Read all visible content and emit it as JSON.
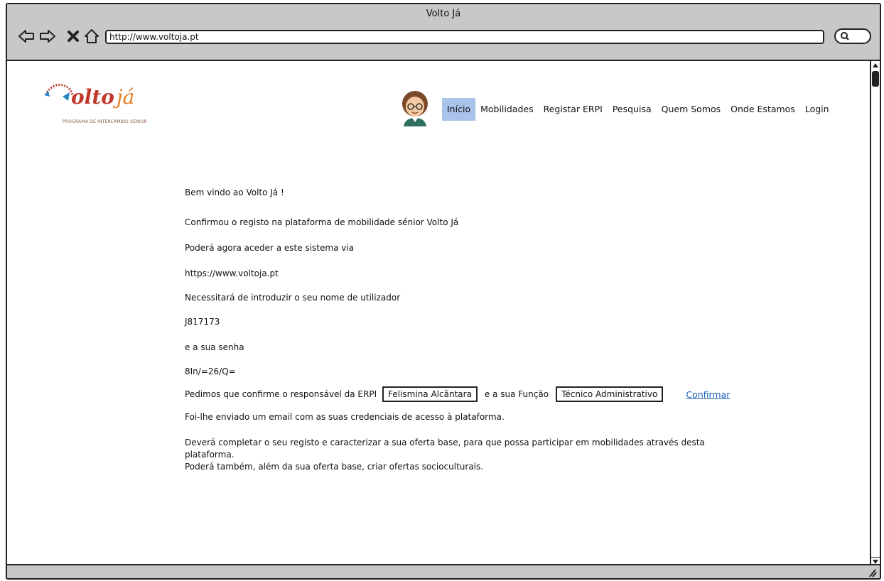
{
  "window": {
    "title": "Volto Já",
    "url": "http://www.voltoja.pt"
  },
  "logo": {
    "brand": "Voltojá",
    "tagline": "PROGRAMA DE INTERCÂMBIO SÉNIOR"
  },
  "nav": {
    "items": [
      {
        "label": "Início",
        "active": true
      },
      {
        "label": "Mobilidades",
        "active": false
      },
      {
        "label": "Registar ERPI",
        "active": false
      },
      {
        "label": "Pesquisa",
        "active": false
      },
      {
        "label": "Quem Somos",
        "active": false
      },
      {
        "label": "Onde Estamos",
        "active": false
      },
      {
        "label": "Login",
        "active": false
      }
    ],
    "active_color": "#a9c3ea"
  },
  "main": {
    "welcome": "Bem vindo ao Volto Já !",
    "confirmed": "Confirmou o registo na plataforma de mobilidade sénior Volto Já",
    "access_via": "Poderá agora aceder a este sistema via",
    "site_url": "https://www.voltoja.pt",
    "username_prompt": "Necessitará de introduzir o seu nome de utilizador",
    "username": "J817173",
    "password_prompt": "e a sua senha",
    "password": "8In/=26/Q=",
    "confirm_prefix": "Pedimos que confirme o responsável da ERPI",
    "responsible_name": "Felismina Alcântara",
    "function_prefix": "e a sua Função",
    "function_value": "Técnico Administrativo",
    "confirm_link": "Confirmar",
    "email_sent": "Foi-lhe enviado um email com as suas credenciais de acesso à plataforma.",
    "complete_line1": "Deverá completar o seu registo e caracterizar a sua oferta base, para que possa participar em mobilidades através desta",
    "complete_line2": "plataforma.",
    "also_line": "Poderá também, além da sua oferta base, criar ofertas socioculturais."
  },
  "colors": {
    "chrome": "#c8c8c8",
    "link": "#1a5fb4"
  }
}
